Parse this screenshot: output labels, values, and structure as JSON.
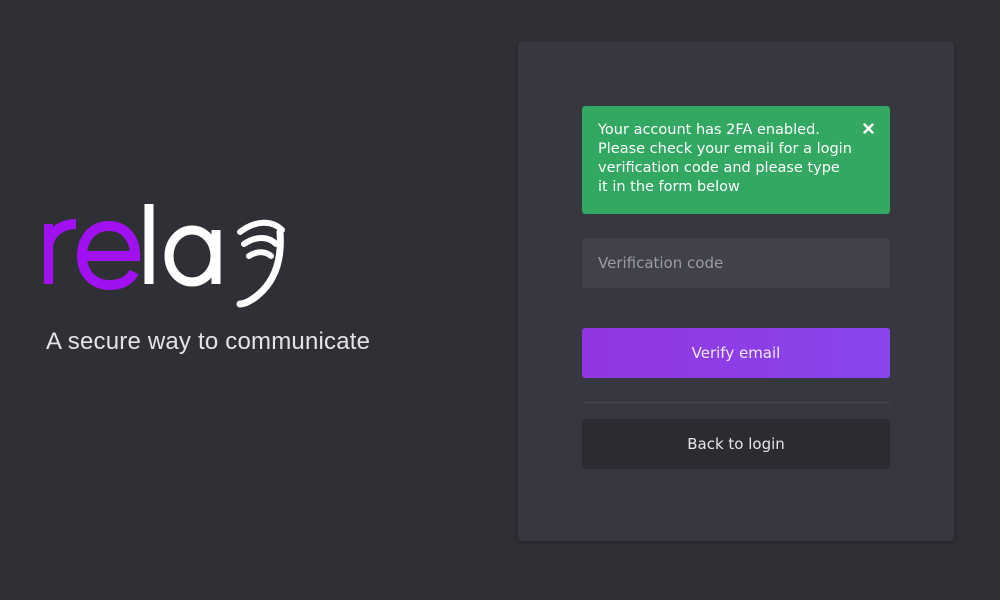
{
  "brand": {
    "logo_text": "relay",
    "tagline": "A secure way to communicate",
    "colors": {
      "logo_accent": "#a010f0",
      "logo_light": "#ffffff"
    }
  },
  "alert": {
    "message": "Your account has 2FA enabled. Please check your email for a login verification code and please type it in the form below",
    "close_icon": "close-icon",
    "color": "#33a863"
  },
  "form": {
    "verification_code": {
      "placeholder": "Verification code",
      "value": ""
    },
    "verify_label": "Verify email",
    "back_label": "Back to login"
  },
  "theme": {
    "background": "#2f3036",
    "card": "#36373f",
    "primary": "#8e3ee6"
  }
}
